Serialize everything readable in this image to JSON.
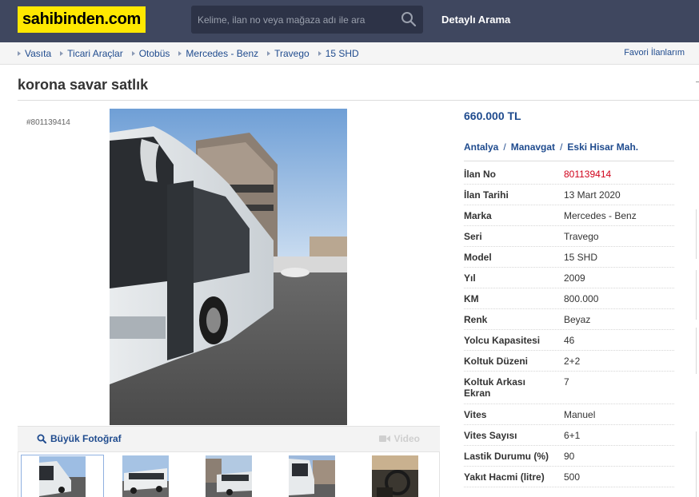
{
  "header": {
    "logo_text": "sahibinden.com",
    "search_placeholder": "Kelime, ilan no veya mağaza adı ile ara",
    "advanced_search_label": "Detaylı Arama"
  },
  "breadcrumb": {
    "items": [
      {
        "label": "Vasıta"
      },
      {
        "label": "Ticari Araçlar"
      },
      {
        "label": "Otobüs"
      },
      {
        "label": "Mercedes - Benz"
      },
      {
        "label": "Travego"
      },
      {
        "label": "15 SHD"
      }
    ],
    "favorites_label": "Favori İlanlarım"
  },
  "listing": {
    "title": "korona savar satlık",
    "id_tag": "#801139414",
    "price": "660.000 TL",
    "location": {
      "city": "Antalya",
      "district": "Manavgat",
      "neighborhood": "Eski Hisar Mah."
    }
  },
  "gallery": {
    "big_photo_label": "Büyük Fotoğraf",
    "video_label": "Video",
    "thumbnail_count": 5
  },
  "details": [
    {
      "key": "İlan No",
      "value": "801139414",
      "highlight": true
    },
    {
      "key": "İlan Tarihi",
      "value": "13 Mart 2020"
    },
    {
      "key": "Marka",
      "value": "Mercedes - Benz"
    },
    {
      "key": "Seri",
      "value": "Travego"
    },
    {
      "key": "Model",
      "value": "15 SHD"
    },
    {
      "key": "Yıl",
      "value": "2009"
    },
    {
      "key": "KM",
      "value": "800.000"
    },
    {
      "key": "Renk",
      "value": "Beyaz"
    },
    {
      "key": "Yolcu Kapasitesi",
      "value": "46"
    },
    {
      "key": "Koltuk Düzeni",
      "value": "2+2"
    },
    {
      "key": "Koltuk Arkası Ekran",
      "value": "7"
    },
    {
      "key": "Vites",
      "value": "Manuel"
    },
    {
      "key": "Vites Sayısı",
      "value": "6+1"
    },
    {
      "key": "Lastik Durumu (%)",
      "value": "90"
    },
    {
      "key": "Yakıt Hacmi (litre)",
      "value": "500"
    }
  ],
  "colors": {
    "header_bg": "#3f475f",
    "logo_bg": "#ffe800",
    "link_blue": "#1f4b8e",
    "id_red": "#d0021b"
  }
}
